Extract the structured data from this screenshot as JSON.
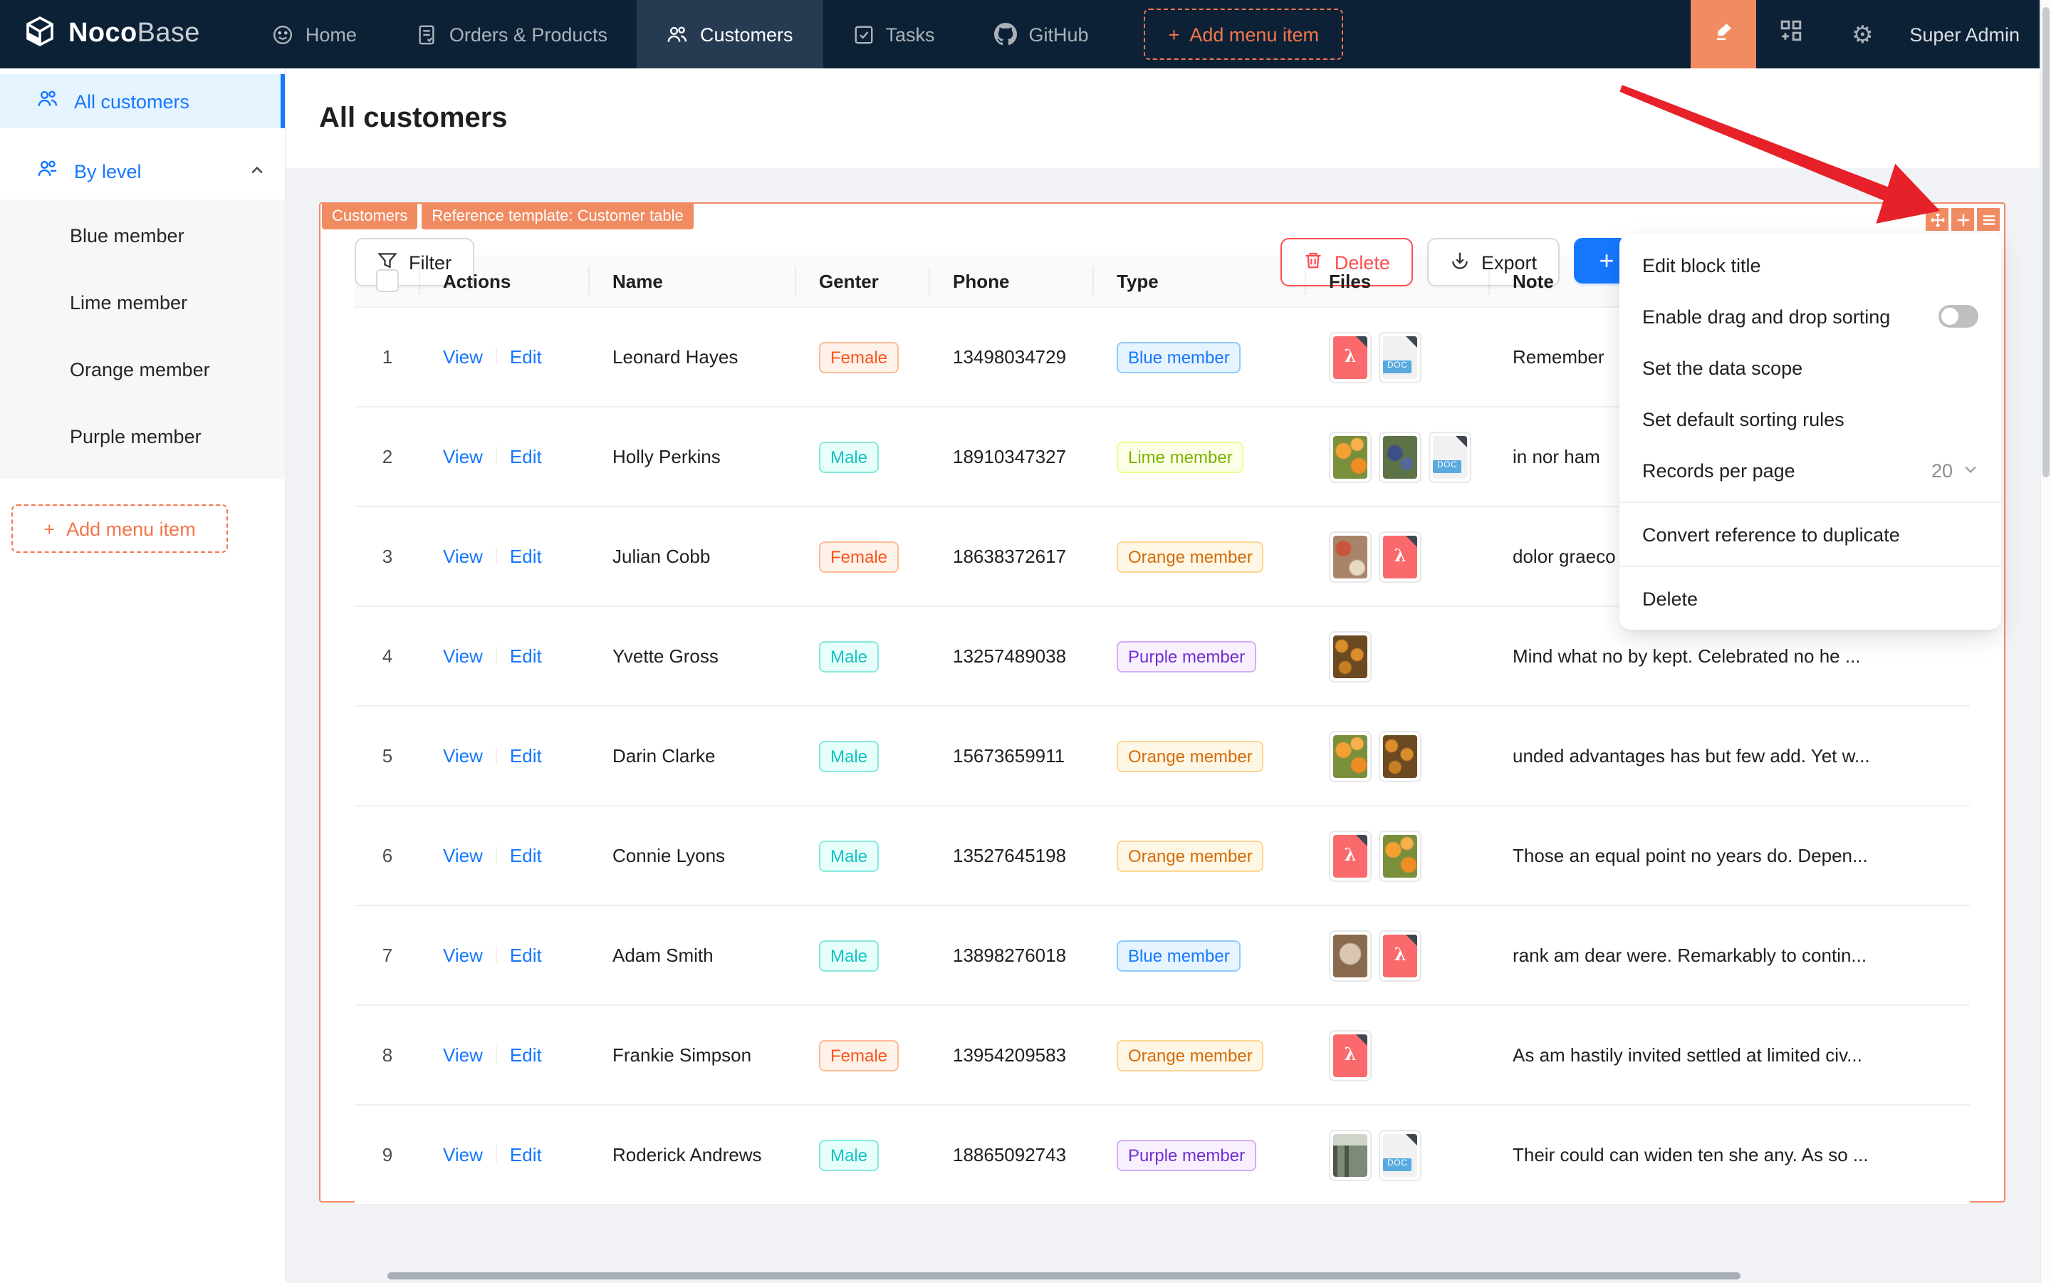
{
  "colors": {
    "accent": "#f18b62",
    "primary": "#1677ff",
    "danger": "#ff4d4f",
    "nav_bg": "#0d2136",
    "nav_active_bg": "#263a52"
  },
  "nav": {
    "logo": {
      "noco": "Noco",
      "base": "Base"
    },
    "items": [
      {
        "label": "Home",
        "icon": "smiley-icon",
        "active": false
      },
      {
        "label": "Orders & Products",
        "icon": "orders-icon",
        "active": false
      },
      {
        "label": "Customers",
        "icon": "customers-icon",
        "active": true
      },
      {
        "label": "Tasks",
        "icon": "tasks-icon",
        "active": false
      },
      {
        "label": "GitHub",
        "icon": "github-icon",
        "active": false
      }
    ],
    "add_menu_item": "Add menu item",
    "right": {
      "user": "Super Admin"
    }
  },
  "sidebar": {
    "items": [
      {
        "label": "All customers",
        "icon": "team-icon",
        "active": true,
        "children": []
      },
      {
        "label": "By level",
        "icon": "team-level-icon",
        "active": false,
        "expanded": true,
        "children": [
          "Blue member",
          "Lime member",
          "Orange member",
          "Purple member"
        ]
      }
    ],
    "add_menu_item": "Add menu item"
  },
  "page": {
    "title": "All customers"
  },
  "block": {
    "tags": [
      "Customers",
      "Reference template: Customer table"
    ],
    "toolbar": {
      "filter": "Filter",
      "delete": "Delete",
      "export": "Export",
      "add": "+"
    },
    "settings_menu": {
      "items": [
        {
          "type": "item",
          "label": "Edit block title"
        },
        {
          "type": "toggle",
          "label": "Enable drag and drop sorting",
          "value": false
        },
        {
          "type": "item",
          "label": "Set the data scope"
        },
        {
          "type": "item",
          "label": "Set default sorting rules"
        },
        {
          "type": "select",
          "label": "Records per page",
          "value": "20"
        },
        {
          "type": "divider"
        },
        {
          "type": "item",
          "label": "Convert reference to duplicate"
        },
        {
          "type": "divider"
        },
        {
          "type": "item",
          "label": "Delete"
        }
      ]
    }
  },
  "table": {
    "columns": [
      "",
      "Actions",
      "Name",
      "Genter",
      "Phone",
      "Type",
      "Files",
      "Note"
    ],
    "action_labels": [
      "View",
      "Edit"
    ],
    "rows": [
      {
        "index": 1,
        "name": "Leonard Hayes",
        "gender": "Female",
        "phone": "13498034729",
        "type": "Blue member",
        "files": [
          "pdf",
          "doc"
        ],
        "note": "Remember"
      },
      {
        "index": 2,
        "name": "Holly Perkins",
        "gender": "Male",
        "phone": "18910347327",
        "type": "Lime member",
        "files": [
          "img-oranges",
          "img-grapes",
          "doc"
        ],
        "note": "in nor ham"
      },
      {
        "index": 3,
        "name": "Julian Cobb",
        "gender": "Female",
        "phone": "18638372617",
        "type": "Orange member",
        "files": [
          "img-food",
          "pdf"
        ],
        "note": "dolor graeco pro, te sea bonorum doloru..."
      },
      {
        "index": 4,
        "name": "Yvette Gross",
        "gender": "Male",
        "phone": "13257489038",
        "type": "Purple member",
        "files": [
          "img-pumpkins"
        ],
        "note": "Mind what no by kept. Celebrated no he ..."
      },
      {
        "index": 5,
        "name": "Darin Clarke",
        "gender": "Male",
        "phone": "15673659911",
        "type": "Orange member",
        "files": [
          "img-oranges",
          "img-pumpkins"
        ],
        "note": "unded advantages has but few add. Yet w..."
      },
      {
        "index": 6,
        "name": "Connie Lyons",
        "gender": "Male",
        "phone": "13527645198",
        "type": "Orange member",
        "files": [
          "pdf",
          "img-oranges"
        ],
        "note": "Those an equal point no years do. Depen..."
      },
      {
        "index": 7,
        "name": "Adam Smith",
        "gender": "Male",
        "phone": "13898276018",
        "type": "Blue member",
        "files": [
          "img-coffee",
          "pdf"
        ],
        "note": "rank am dear were. Remarkably to contin..."
      },
      {
        "index": 8,
        "name": "Frankie Simpson",
        "gender": "Female",
        "phone": "13954209583",
        "type": "Orange member",
        "files": [
          "pdf"
        ],
        "note": "As am hastily invited settled at limited civ..."
      },
      {
        "index": 9,
        "name": "Roderick Andrews",
        "gender": "Male",
        "phone": "18865092743",
        "type": "Purple member",
        "files": [
          "img-storefront",
          "doc"
        ],
        "note": "Their could can widen ten she any. As so ..."
      }
    ]
  }
}
